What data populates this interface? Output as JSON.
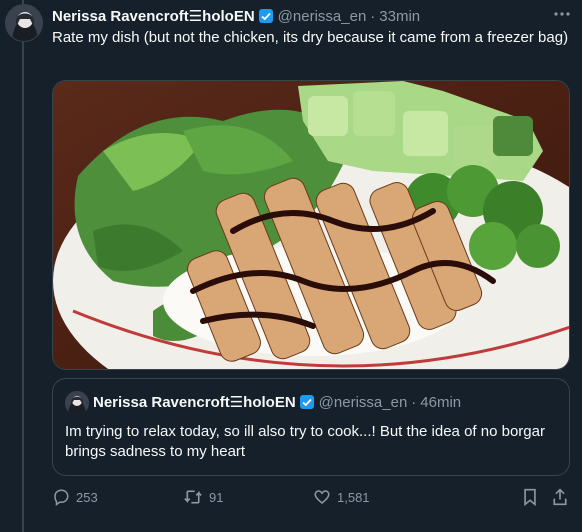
{
  "tweet": {
    "author_name": "Nerissa Ravencroft☰holoEN",
    "handle": "@nerissa_en",
    "separator": "·",
    "time": "33min",
    "text": "Rate my dish (but not the chicken, its dry because it came from a freezer bag)",
    "verified_icon": "verified-badge-icon",
    "more_icon": "more-options-icon"
  },
  "quote": {
    "author_name": "Nerissa Ravencroft☰holoEN",
    "handle": "@nerissa_en",
    "separator": "·",
    "time": "46min",
    "text": "Im trying to relax today, so ill also try to cook...! But the idea of no borgar brings sadness to my heart"
  },
  "actions": {
    "reply_count": "253",
    "retweet_count": "91",
    "like_count": "1,581",
    "icons": [
      "reply-icon",
      "retweet-icon",
      "like-icon",
      "bookmark-icon",
      "share-icon"
    ]
  },
  "colors": {
    "background": "#15202b",
    "border": "#38444d",
    "muted_text": "#8b98a5",
    "verified": "#1d9bf0"
  }
}
